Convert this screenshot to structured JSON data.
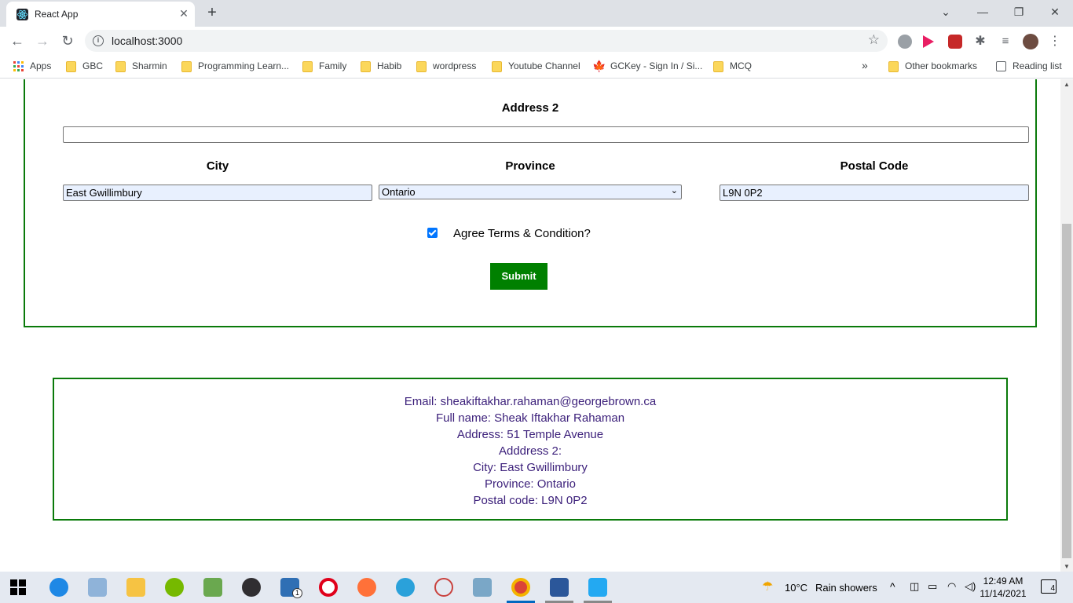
{
  "browser": {
    "tab_title": "React App",
    "url": "localhost:3000",
    "bookmarks": [
      {
        "label": "Apps",
        "icon": "apps-grid-icon"
      },
      {
        "label": "GBC",
        "icon": "folder-icon"
      },
      {
        "label": "Sharmin",
        "icon": "folder-icon"
      },
      {
        "label": "Programming Learn...",
        "icon": "folder-icon"
      },
      {
        "label": "Family",
        "icon": "folder-icon"
      },
      {
        "label": "Habib",
        "icon": "folder-icon"
      },
      {
        "label": "wordpress",
        "icon": "folder-icon"
      },
      {
        "label": "Youtube Channel",
        "icon": "folder-icon"
      },
      {
        "label": "GCKey - Sign In / Si...",
        "icon": "maple-leaf-icon"
      },
      {
        "label": "MCQ",
        "icon": "folder-icon"
      }
    ],
    "overflow": "»",
    "other_bookmarks": "Other bookmarks",
    "reading_list": "Reading list"
  },
  "form": {
    "address2_label": "Address 2",
    "address2_value": "",
    "city_label": "City",
    "city_value": "East Gwillimbury",
    "province_label": "Province",
    "province_value": "Ontario",
    "postal_label": "Postal Code",
    "postal_value": "L9N 0P2",
    "agree_label": "Agree Terms & Condition?",
    "agree_checked": true,
    "submit_label": "Submit"
  },
  "summary": {
    "email": "Email: sheakiftakhar.rahaman@georgebrown.ca",
    "full_name": "Full name: Sheak Iftakhar Rahaman",
    "address": "Address: 51 Temple Avenue",
    "address2": "Adddress 2:",
    "city": "City: East Gwillimbury",
    "province": "Province: Ontario",
    "postal": "Postal code: L9N 0P2"
  },
  "taskbar": {
    "weather_temp": "10°C",
    "weather_text": "Rain showers",
    "time": "12:49 AM",
    "date": "11/14/2021",
    "notifications": "4",
    "mail_badge": "1"
  },
  "colors": {
    "accent_green": "#008000",
    "border_green": "#0a7a0a",
    "summary_text": "#3b1f7a",
    "autofill_bg": "#e8f0fe"
  }
}
